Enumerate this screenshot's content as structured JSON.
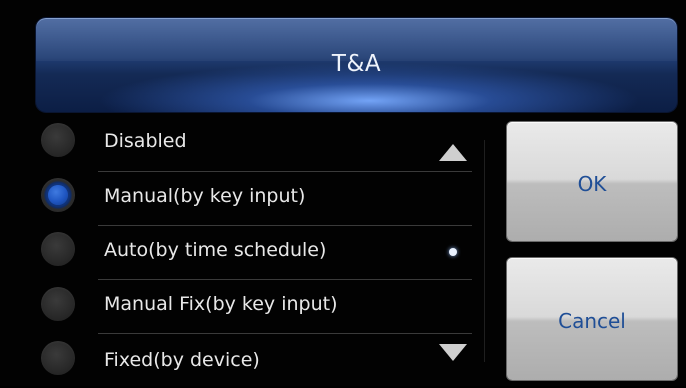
{
  "dialog": {
    "title": "T&A"
  },
  "options": [
    {
      "label": "Disabled",
      "selected": false
    },
    {
      "label": "Manual(by key input)",
      "selected": true
    },
    {
      "label": "Auto(by time schedule)",
      "selected": false
    },
    {
      "label": "Manual Fix(by key input)",
      "selected": false
    },
    {
      "label": "Fixed(by device)",
      "selected": false
    }
  ],
  "scroll": {
    "up_icon": "triangle-up-icon",
    "down_icon": "triangle-down-icon",
    "position_icon": "scroll-position-dot"
  },
  "buttons": {
    "ok_label": "OK",
    "cancel_label": "Cancel"
  },
  "colors": {
    "title_bar": "#1c3a72",
    "radio_selected": "#1f56c2",
    "button_text": "#1f4e96",
    "background": "#000000"
  }
}
